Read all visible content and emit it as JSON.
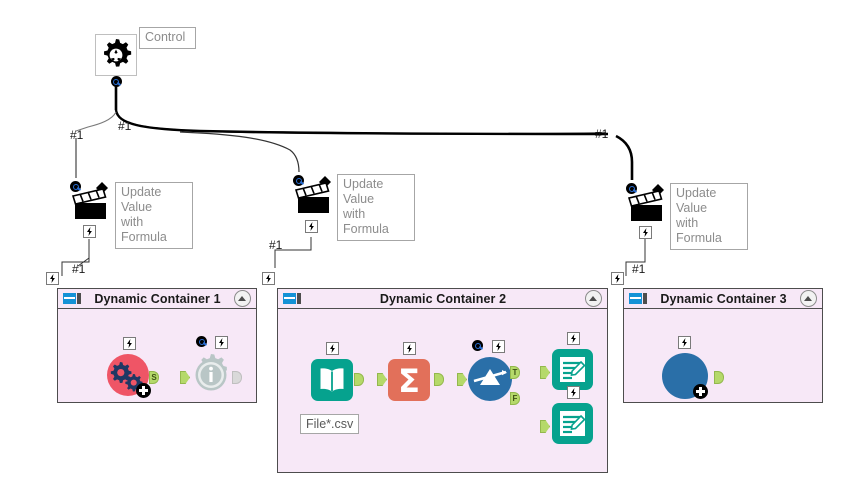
{
  "canvas": {
    "title": "Workflow Canvas",
    "background": "#ffffff"
  },
  "colors": {
    "container_fill": "#f7e8f7",
    "container_border": "#4d4d4d",
    "container_icon_blue": "#1492d6",
    "teal": "#06a28e",
    "orange": "#e2705a",
    "blue": "#2a6fa8",
    "red": "#ef5566",
    "port_green": "#b5d96a",
    "label_text": "#8c8c8c",
    "connector": "#000000"
  },
  "control": {
    "label": "Control",
    "icon": "gear-icon",
    "output_port": "query-port"
  },
  "update_nodes": [
    {
      "label": "Update Value\nwith Formula",
      "icon": "clapperboard-icon",
      "input_badge": "query-badge",
      "output_badge": "bolt-badge",
      "incoming_connector_label": "#1",
      "outgoing_connector_label": "#1"
    },
    {
      "label": "Update Value\nwith Formula",
      "icon": "clapperboard-icon",
      "input_badge": "query-badge",
      "output_badge": "bolt-badge",
      "incoming_connector_label": "#1",
      "outgoing_connector_label": "#1"
    },
    {
      "label": "Update Value\nwith Formula",
      "icon": "clapperboard-icon",
      "input_badge": "query-badge",
      "output_badge": "bolt-badge",
      "incoming_connector_label": "#1",
      "outgoing_connector_label": "#1"
    }
  ],
  "connector_labels": {
    "control_out_left": "#1",
    "control_out_mid": "#1",
    "control_out_right": "#1",
    "branch_left": "#1",
    "to_container_1": "#1",
    "to_container_2": "#1",
    "to_container_3": "#1"
  },
  "containers": [
    {
      "title": "Dynamic Container 1",
      "icon": "container-icon",
      "collapse_label": "collapse",
      "nodes": [
        {
          "name": "batch-macro-icon",
          "badge": "bolt-badge",
          "out_port": "S"
        },
        {
          "name": "info-gear-icon",
          "badges": [
            "query-badge",
            "bolt-badge"
          ],
          "out_port": ""
        }
      ]
    },
    {
      "title": "Dynamic Container 2",
      "icon": "container-icon",
      "collapse_label": "collapse",
      "nodes": [
        {
          "name": "input-data-icon",
          "badge": "bolt-badge",
          "label": "File*.csv"
        },
        {
          "name": "summarize-icon",
          "badge": "bolt-badge"
        },
        {
          "name": "filter-icon",
          "badges": [
            "query-badge",
            "bolt-badge"
          ],
          "out_ports": [
            "T",
            "F"
          ]
        },
        {
          "name": "output-data-icon-true",
          "badge": "bolt-badge"
        },
        {
          "name": "output-data-icon-false",
          "badge": "bolt-badge"
        }
      ]
    },
    {
      "title": "Dynamic Container 3",
      "icon": "container-icon",
      "collapse_label": "collapse",
      "nodes": [
        {
          "name": "macro-icon",
          "badge": "bolt-badge",
          "out_port": ""
        }
      ]
    }
  ]
}
